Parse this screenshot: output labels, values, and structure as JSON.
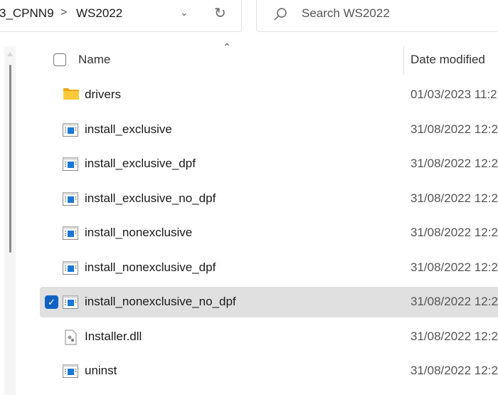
{
  "address_bar": {
    "crumbs": [
      "3_CPNN9",
      "WS2022"
    ],
    "separator": ">"
  },
  "search": {
    "placeholder": "Search WS2022"
  },
  "columns": {
    "name": "Name",
    "date_modified": "Date modified"
  },
  "files": [
    {
      "name": "drivers",
      "type": "folder",
      "date": "01/03/2023 11:2",
      "selected": false
    },
    {
      "name": "install_exclusive",
      "type": "app",
      "date": "31/08/2022 12:2",
      "selected": false
    },
    {
      "name": "install_exclusive_dpf",
      "type": "app",
      "date": "31/08/2022 12:2",
      "selected": false
    },
    {
      "name": "install_exclusive_no_dpf",
      "type": "app",
      "date": "31/08/2022 12:2",
      "selected": false
    },
    {
      "name": "install_nonexclusive",
      "type": "app",
      "date": "31/08/2022 12:2",
      "selected": false
    },
    {
      "name": "install_nonexclusive_dpf",
      "type": "app",
      "date": "31/08/2022 12:2",
      "selected": false
    },
    {
      "name": "install_nonexclusive_no_dpf",
      "type": "app",
      "date": "31/08/2022 12:2",
      "selected": true
    },
    {
      "name": "Installer.dll",
      "type": "dll",
      "date": "31/08/2022 12:2",
      "selected": false
    },
    {
      "name": "uninst",
      "type": "app",
      "date": "31/08/2022 12:2",
      "selected": false
    }
  ],
  "colors": {
    "accent": "#0f62c4",
    "selected_row": "#e0e0e0"
  }
}
